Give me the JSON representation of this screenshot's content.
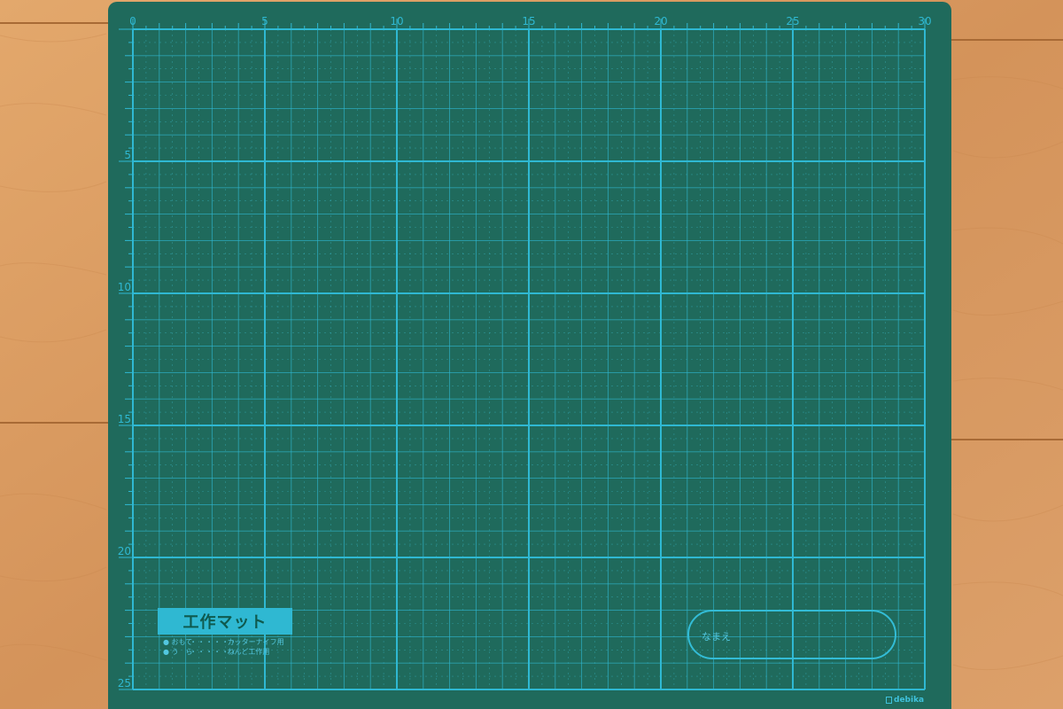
{
  "scene": {
    "subject": "cutting-mat"
  },
  "colors": {
    "floor": "#d79a5f",
    "mat": "#1f6a5c",
    "lines": "#2fb8d2"
  },
  "mat": {
    "top_ruler_numbers": [
      "0",
      "5",
      "10",
      "15",
      "20",
      "25",
      "30"
    ],
    "left_ruler_numbers": [
      "5",
      "10",
      "15",
      "20",
      "25"
    ],
    "title": "工作マット",
    "usage": [
      {
        "side": "おもて",
        "dots": "・・・・・・",
        "use": "カッターナイフ用"
      },
      {
        "side": "う　ら",
        "dots": "・・・・・・",
        "use": "ねんど工作用"
      }
    ],
    "name_label": "なまえ",
    "brand": "debika"
  }
}
